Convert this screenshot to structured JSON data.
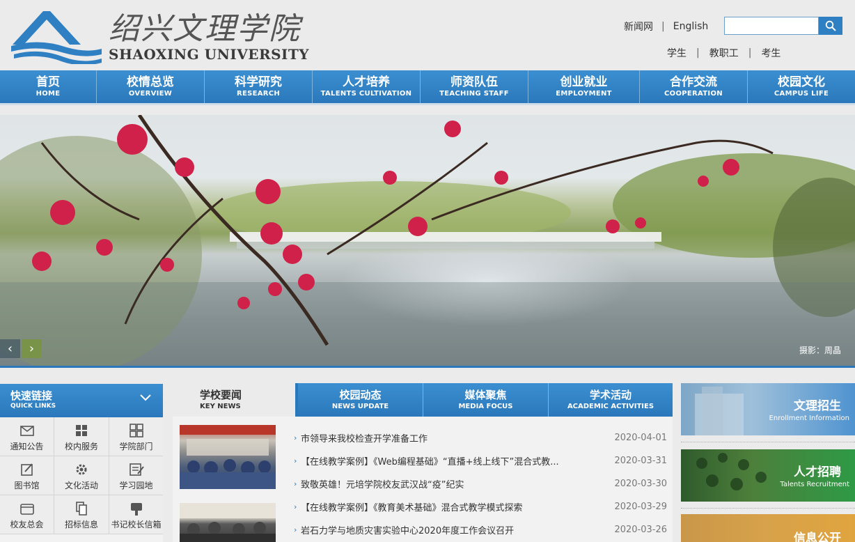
{
  "header": {
    "logo_cn": "绍兴文理学院",
    "logo_en": "SHAOXING UNIVERSITY",
    "top_links": [
      "新闻网",
      "English"
    ],
    "search": {
      "value": "",
      "placeholder": ""
    },
    "role_links": [
      "学生",
      "教职工",
      "考生"
    ]
  },
  "nav": [
    {
      "cn": "首页",
      "en": "HOME"
    },
    {
      "cn": "校情总览",
      "en": "OVERVIEW"
    },
    {
      "cn": "科学研究",
      "en": "RESEARCH"
    },
    {
      "cn": "人才培养",
      "en": "TALENTS CULTIVATION"
    },
    {
      "cn": "师资队伍",
      "en": "TEACHING STAFF"
    },
    {
      "cn": "创业就业",
      "en": "EMPLOYMENT"
    },
    {
      "cn": "合作交流",
      "en": "COOPERATION"
    },
    {
      "cn": "校园文化",
      "en": "CAMPUS LIFE"
    }
  ],
  "banner": {
    "credit": "摄影：周晶"
  },
  "quick_links": {
    "title": "快速链接",
    "subtitle": "QUICK LINKS",
    "items": [
      {
        "label": "通知公告",
        "icon": "mail-icon"
      },
      {
        "label": "校内服务",
        "icon": "grid-icon"
      },
      {
        "label": "学院部门",
        "icon": "squares-icon"
      },
      {
        "label": "图书馆",
        "icon": "edit-icon"
      },
      {
        "label": "文化活动",
        "icon": "gear-icon"
      },
      {
        "label": "学习园地",
        "icon": "notebook-icon"
      },
      {
        "label": "校友总会",
        "icon": "inbox-icon"
      },
      {
        "label": "招标信息",
        "icon": "document-icon"
      },
      {
        "label": "书记校长信箱",
        "icon": "mailbox-icon"
      }
    ]
  },
  "news": {
    "tabs": [
      {
        "cn": "学校要闻",
        "en": "KEY NEWS"
      },
      {
        "cn": "校园动态",
        "en": "NEWS UPDATE"
      },
      {
        "cn": "媒体聚焦",
        "en": "MEDIA FOCUS"
      },
      {
        "cn": "学术活动",
        "en": "ACADEMIC ACTIVITIES"
      }
    ],
    "items": [
      {
        "title": "市领导来我校检查开学准备工作",
        "date": "2020-04-01"
      },
      {
        "title": "【在线教学案例】《Web编程基础》“直播+线上线下”混合式教...",
        "date": "2020-03-31"
      },
      {
        "title": "致敬英雄！元培学院校友武汉战“疫”纪实",
        "date": "2020-03-30"
      },
      {
        "title": "【在线教学案例】《教育美术基础》混合式教学模式探索",
        "date": "2020-03-29"
      },
      {
        "title": "岩石力学与地质灾害实验中心2020年度工作会议召开",
        "date": "2020-03-26"
      }
    ]
  },
  "promos": [
    {
      "cn": "文理招生",
      "en": "Enrollment Information"
    },
    {
      "cn": "人才招聘",
      "en": "Talents Recruitment"
    },
    {
      "cn": "信息公开",
      "en": ""
    }
  ],
  "colors": {
    "brand_blue": "#2a78bb",
    "nav_light": "#3b8fd0"
  }
}
